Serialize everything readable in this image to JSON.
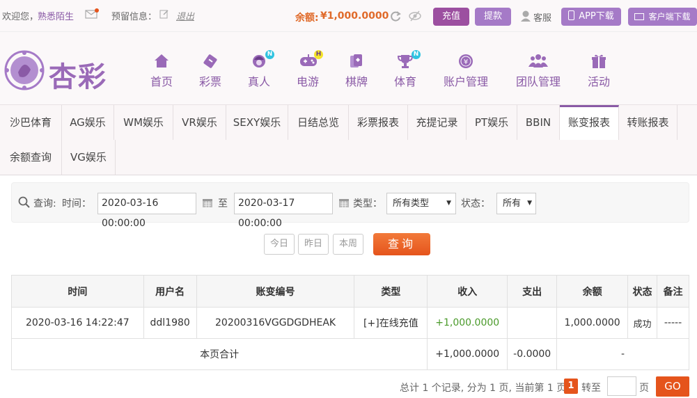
{
  "topbar": {
    "welcome": "欢迎您，",
    "username": "熟悉陌生",
    "reserved_label": "预留信息：",
    "logout": "退出",
    "balance_label": "余额:",
    "balance_value": "¥1,000.0000",
    "recharge": "充值",
    "withdraw": "提款",
    "service": "客服",
    "app_download": "APP下载",
    "client_download": "客户端下载"
  },
  "logo": {
    "text": "杏彩"
  },
  "nav": [
    {
      "label": "首页",
      "icon": "home-icon",
      "badge": ""
    },
    {
      "label": "彩票",
      "icon": "lottery-icon",
      "badge": ""
    },
    {
      "label": "真人",
      "icon": "live-dealer-icon",
      "badge": "N"
    },
    {
      "label": "电游",
      "icon": "gamepad-icon",
      "badge": "H"
    },
    {
      "label": "棋牌",
      "icon": "cards-icon",
      "badge": ""
    },
    {
      "label": "体育",
      "icon": "trophy-icon",
      "badge": "N"
    },
    {
      "label": "账户管理",
      "icon": "yen-coin-icon",
      "badge": ""
    },
    {
      "label": "团队管理",
      "icon": "team-icon",
      "badge": ""
    },
    {
      "label": "活动",
      "icon": "gift-icon",
      "badge": ""
    }
  ],
  "tabs": [
    "沙巴体育",
    "AG娱乐",
    "WM娱乐",
    "VR娱乐",
    "SEXY娱乐",
    "日结总览",
    "彩票报表",
    "充提记录",
    "PT娱乐",
    "BBIN",
    "账变报表",
    "转账报表",
    "余额查询",
    "VG娱乐"
  ],
  "active_tab": "账变报表",
  "query": {
    "label": "查询:",
    "time_label": "时间：",
    "start": "2020-03-16 00:00:00",
    "to": "至",
    "end": "2020-03-17 00:00:00",
    "type_label": "类型：",
    "type_value": "所有类型",
    "status_label": "状态：",
    "status_value": "所有",
    "today": "今日",
    "yesterday": "昨日",
    "this_week": "本周",
    "search": "查询"
  },
  "table": {
    "headers": [
      "时间",
      "用户名",
      "账变编号",
      "类型",
      "收入",
      "支出",
      "余额",
      "状态",
      "备注"
    ],
    "rows": [
      [
        "2020-03-16 14:22:47",
        "ddl1980",
        "20200316VGGDGDHEAK",
        "[+]在线充值",
        "+1,000.0000",
        "",
        "1,000.0000",
        "成功",
        "-----"
      ]
    ],
    "summary": {
      "label": "本页合计",
      "income": "+1,000.0000",
      "expense": "-0.0000",
      "balance": "-"
    }
  },
  "pager": {
    "summary": "总计 1 个记录, 分为 1 页, 当前第 1 页",
    "current": "1",
    "goto": "转至",
    "page_unit": "页",
    "go": "GO"
  },
  "colors": {
    "purple": "#8a5aa6",
    "orange": "#e5541c",
    "green": "#4a9a2a"
  }
}
